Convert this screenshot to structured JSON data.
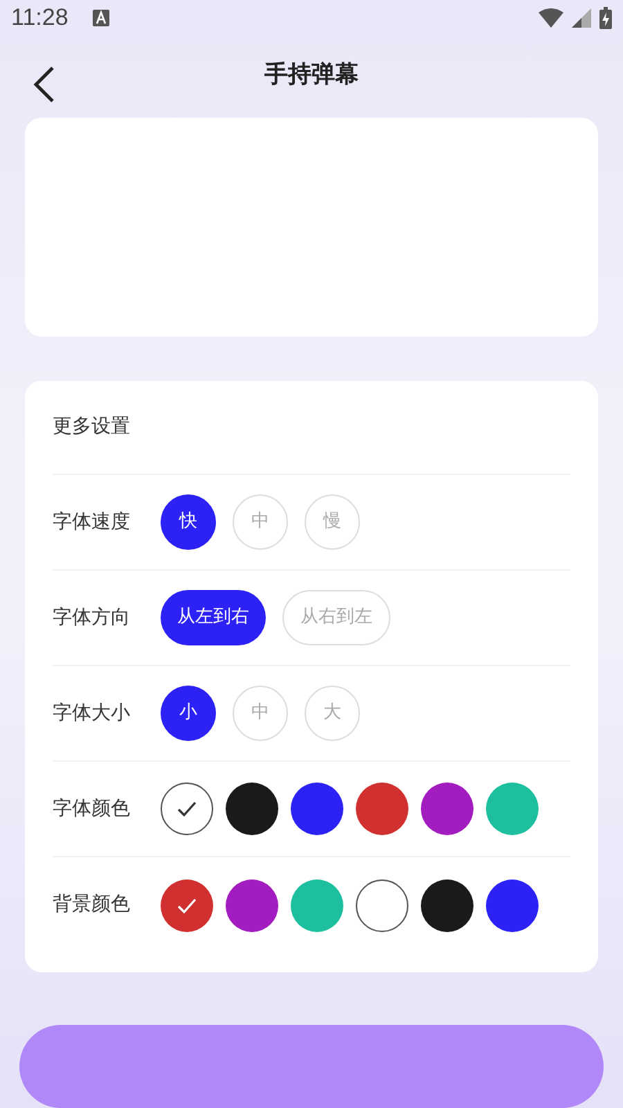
{
  "status_bar": {
    "time": "11:28"
  },
  "header": {
    "title": "手持弹幕"
  },
  "settings": {
    "title": "更多设置",
    "rows": [
      {
        "kind": "options",
        "label": "字体速度",
        "options": [
          {
            "label": "快",
            "selected": true
          },
          {
            "label": "中",
            "selected": false
          },
          {
            "label": "慢",
            "selected": false
          }
        ]
      },
      {
        "kind": "options",
        "label": "字体方向",
        "options": [
          {
            "label": "从左到右",
            "selected": true
          },
          {
            "label": "从右到左",
            "selected": false
          }
        ]
      },
      {
        "kind": "options",
        "label": "字体大小",
        "options": [
          {
            "label": "小",
            "selected": true
          },
          {
            "label": "中",
            "selected": false
          },
          {
            "label": "大",
            "selected": false
          }
        ]
      },
      {
        "kind": "colors",
        "label": "字体颜色",
        "swatches": [
          {
            "color": "#ffffff",
            "selected": true
          },
          {
            "color": "#1a1a1a",
            "selected": false
          },
          {
            "color": "#2d22f5",
            "selected": false
          },
          {
            "color": "#d03030",
            "selected": false
          },
          {
            "color": "#a21cc0",
            "selected": false
          },
          {
            "color": "#1dbf9f",
            "selected": false
          }
        ]
      },
      {
        "kind": "colors",
        "label": "背景颜色",
        "swatches": [
          {
            "color": "#d03030",
            "selected": true
          },
          {
            "color": "#a21cc0",
            "selected": false
          },
          {
            "color": "#1dbf9f",
            "selected": false
          },
          {
            "color": "#ffffff",
            "selected": false
          },
          {
            "color": "#1a1a1a",
            "selected": false
          },
          {
            "color": "#2d22f5",
            "selected": false
          }
        ]
      }
    ]
  }
}
